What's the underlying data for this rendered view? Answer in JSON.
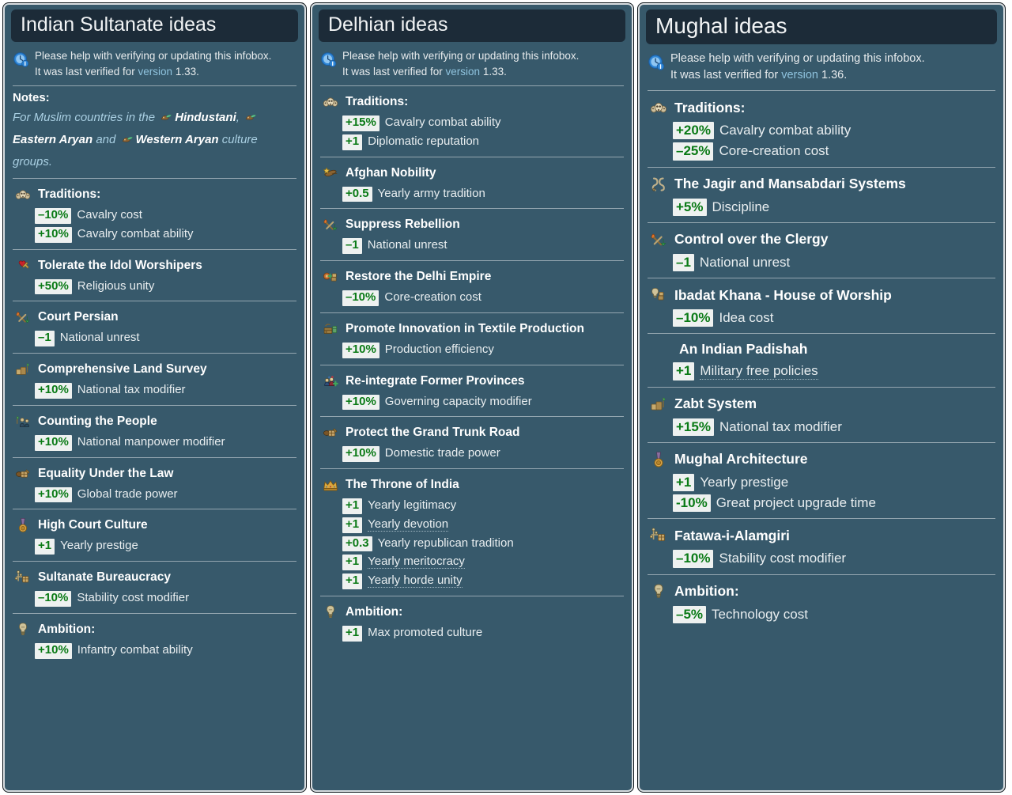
{
  "page": {
    "background": "#ffffff",
    "panel_bg": "#37596b",
    "title_bg": "#1c2b38",
    "badge_bg": "#eef1f0",
    "badge_text_color": "#0a7a16",
    "link_color": "#8fc3de"
  },
  "columns": [
    {
      "id": "indian-sultanate",
      "title": "Indian Sultanate ideas",
      "verify": {
        "icon": "verify-clock-icon",
        "line1": "Please help with verifying or updating this infobox.",
        "line2_prefix": "It was last verified for ",
        "version_label": "version",
        "version_number": "1.33",
        "line2_suffix": "."
      },
      "notes": {
        "heading": "Notes:",
        "segments": [
          {
            "type": "text",
            "text": "For Muslim countries in the "
          },
          {
            "type": "icon",
            "icon": "culture-group-icon"
          },
          {
            "type": "bold",
            "text": "Hindustani"
          },
          {
            "type": "text",
            "text": ", "
          },
          {
            "type": "icon",
            "icon": "culture-group-icon"
          },
          {
            "type": "bold",
            "text": "Eastern Aryan"
          },
          {
            "type": "text",
            "text": " and "
          },
          {
            "type": "icon",
            "icon": "culture-group-icon"
          },
          {
            "type": "bold",
            "text": "Western Aryan"
          },
          {
            "type": "text",
            "text": " culture groups."
          }
        ]
      },
      "groups": [
        {
          "icon": "traditions-skulls-icon",
          "name": "Traditions:",
          "effects": [
            {
              "value": "–10%",
              "label": "Cavalry cost"
            },
            {
              "value": "+10%",
              "label": "Cavalry combat ability"
            }
          ]
        },
        {
          "icon": "heart-cross-icon",
          "name": "Tolerate the Idol Worshipers",
          "effects": [
            {
              "value": "+50%",
              "label": "Religious unity"
            }
          ]
        },
        {
          "icon": "torch-down-icon",
          "name": "Court Persian",
          "effects": [
            {
              "value": "–1",
              "label": "National unrest"
            }
          ]
        },
        {
          "icon": "land-survey-icon",
          "name": "Comprehensive Land Survey",
          "effects": [
            {
              "value": "+10%",
              "label": "National tax modifier"
            }
          ]
        },
        {
          "icon": "census-icon",
          "name": "Counting the People",
          "effects": [
            {
              "value": "+10%",
              "label": "National manpower modifier"
            }
          ]
        },
        {
          "icon": "trade-goods-icon",
          "name": "Equality Under the Law",
          "effects": [
            {
              "value": "+10%",
              "label": "Global trade power"
            }
          ]
        },
        {
          "icon": "medal-icon",
          "name": "High Court Culture",
          "effects": [
            {
              "value": "+1",
              "label": "Yearly prestige"
            }
          ]
        },
        {
          "icon": "bureaucracy-icon",
          "name": "Sultanate Bureaucracy",
          "effects": [
            {
              "value": "–10%",
              "label": "Stability cost modifier"
            }
          ]
        },
        {
          "icon": "lightbulb-icon",
          "name": "Ambition:",
          "effects": [
            {
              "value": "+10%",
              "label": "Infantry combat ability"
            }
          ]
        }
      ]
    },
    {
      "id": "delhian",
      "title": "Delhian ideas",
      "verify": {
        "icon": "verify-clock-icon",
        "line1": "Please help with verifying or updating this infobox.",
        "line2_prefix": "It was last verified for ",
        "version_label": "version",
        "version_number": "1.33",
        "line2_suffix": "."
      },
      "notes": null,
      "groups": [
        {
          "icon": "traditions-skulls-icon",
          "name": "Traditions:",
          "effects": [
            {
              "value": "+15%",
              "label": "Cavalry combat ability"
            },
            {
              "value": "+1",
              "label": "Diplomatic reputation"
            }
          ]
        },
        {
          "icon": "army-tradition-icon",
          "name": "Afghan Nobility",
          "effects": [
            {
              "value": "+0.5",
              "label": "Yearly army tradition"
            }
          ]
        },
        {
          "icon": "torch-down-icon",
          "name": "Suppress Rebellion",
          "effects": [
            {
              "value": "–1",
              "label": "National unrest"
            }
          ]
        },
        {
          "icon": "core-creation-icon",
          "name": "Restore the Delhi Empire",
          "effects": [
            {
              "value": "–10%",
              "label": "Core-creation cost"
            }
          ]
        },
        {
          "icon": "production-icon",
          "name": "Promote Innovation in Textile Production",
          "effects": [
            {
              "value": "+10%",
              "label": "Production efficiency"
            }
          ]
        },
        {
          "icon": "governing-capacity-icon",
          "name": "Re-integrate Former Provinces",
          "effects": [
            {
              "value": "+10%",
              "label": "Governing capacity modifier"
            }
          ]
        },
        {
          "icon": "trade-goods-icon",
          "name": "Protect the Grand Trunk Road",
          "effects": [
            {
              "value": "+10%",
              "label": "Domestic trade power"
            }
          ]
        },
        {
          "icon": "crown-icon",
          "name": "The Throne of India",
          "effects": [
            {
              "value": "+1",
              "label": "Yearly legitimacy"
            },
            {
              "value": "+1",
              "label": "Yearly devotion",
              "hinted": true
            },
            {
              "value": "+0.3",
              "label": "Yearly republican tradition"
            },
            {
              "value": "+1",
              "label": "Yearly meritocracy",
              "hinted": true
            },
            {
              "value": "+1",
              "label": "Yearly horde unity",
              "hinted": true
            }
          ]
        },
        {
          "icon": "lightbulb-icon",
          "name": "Ambition:",
          "effects": [
            {
              "value": "+1",
              "label": "Max promoted culture"
            }
          ]
        }
      ]
    },
    {
      "id": "mughal",
      "title": "Mughal ideas",
      "verify": {
        "icon": "verify-clock-icon",
        "line1": "Please help with verifying or updating this infobox.",
        "line2_prefix": "It was last verified for ",
        "version_label": "version",
        "version_number": "1.36",
        "line2_suffix": "."
      },
      "notes": null,
      "groups": [
        {
          "icon": "traditions-skulls-icon",
          "name": "Traditions:",
          "effects": [
            {
              "value": "+20%",
              "label": "Cavalry combat ability"
            },
            {
              "value": "–25%",
              "label": "Core-creation cost"
            }
          ]
        },
        {
          "icon": "discipline-icon",
          "name": "The Jagir and Mansabdari Systems",
          "effects": [
            {
              "value": "+5%",
              "label": "Discipline"
            }
          ]
        },
        {
          "icon": "torch-down-icon",
          "name": "Control over the Clergy",
          "effects": [
            {
              "value": "–1",
              "label": "National unrest"
            }
          ]
        },
        {
          "icon": "idea-cost-icon",
          "name": "Ibadat Khana - House of Worship",
          "effects": [
            {
              "value": "–10%",
              "label": "Idea cost"
            }
          ]
        },
        {
          "icon": null,
          "name": "An Indian Padishah",
          "effects": [
            {
              "value": "+1",
              "label": "Military free policies",
              "hinted": true
            }
          ]
        },
        {
          "icon": "land-survey-icon",
          "name": "Zabt System",
          "effects": [
            {
              "value": "+15%",
              "label": "National tax modifier"
            }
          ]
        },
        {
          "icon": "medal-icon",
          "name": "Mughal Architecture",
          "effects": [
            {
              "value": "+1",
              "label": "Yearly prestige"
            },
            {
              "value": "-10%",
              "label": "Great project upgrade time"
            }
          ]
        },
        {
          "icon": "bureaucracy-icon",
          "name": "Fatawa-i-Alamgiri",
          "effects": [
            {
              "value": "–10%",
              "label": "Stability cost modifier"
            }
          ]
        },
        {
          "icon": "lightbulb-icon",
          "name": "Ambition:",
          "effects": [
            {
              "value": "–5%",
              "label": "Technology cost"
            }
          ]
        }
      ]
    }
  ]
}
